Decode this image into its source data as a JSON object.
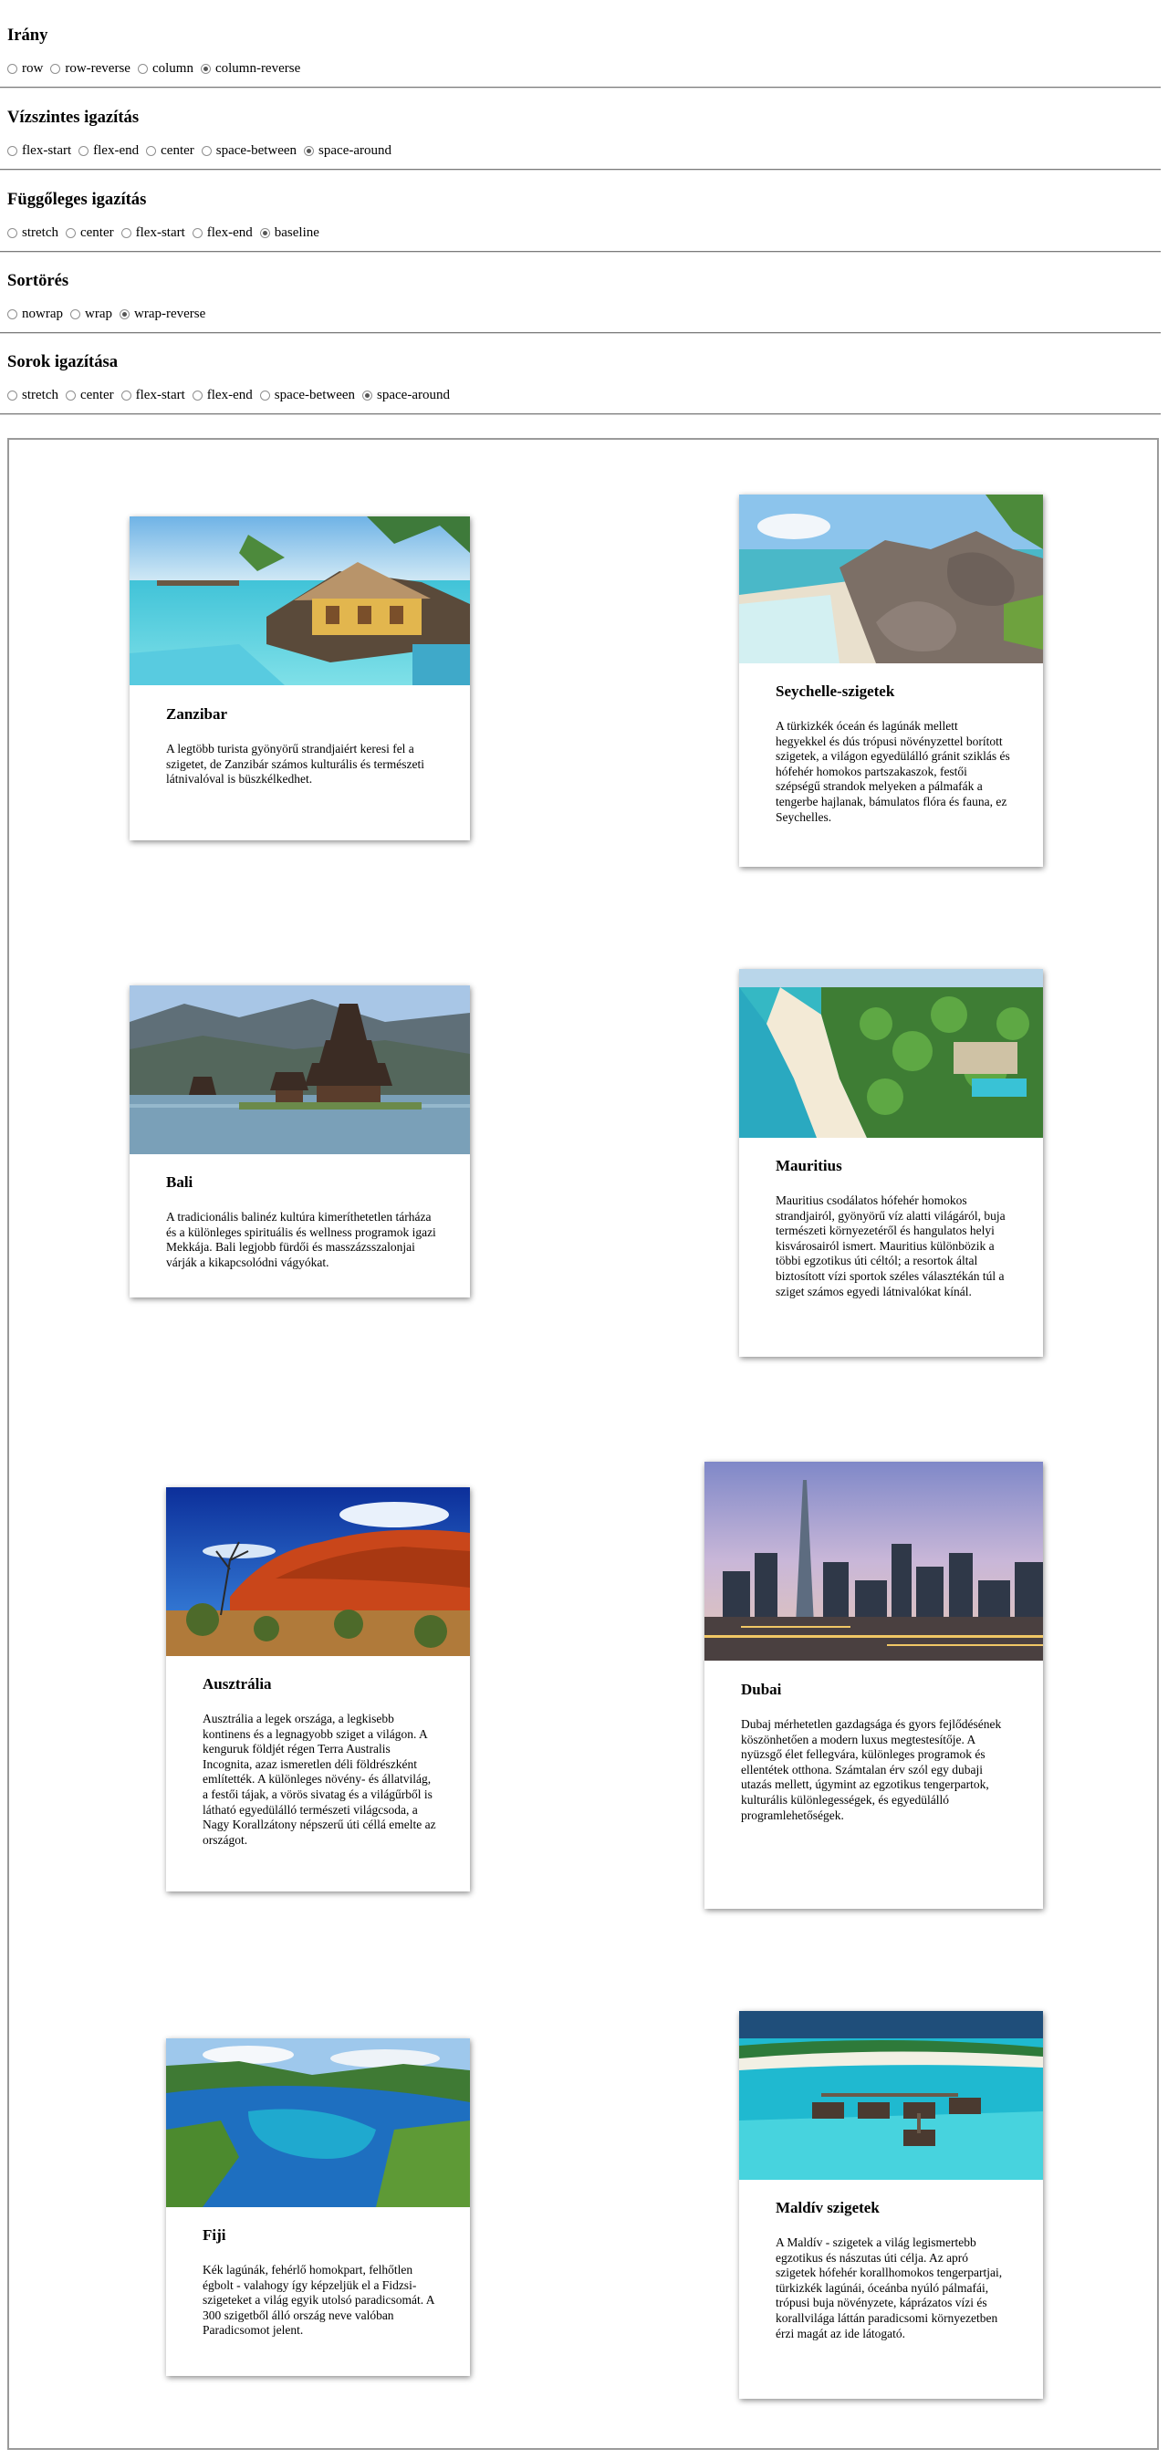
{
  "controls": [
    {
      "title": "Irány",
      "options": [
        "row",
        "row-reverse",
        "column",
        "column-reverse"
      ],
      "selected": 3
    },
    {
      "title": "Vízszintes igazítás",
      "options": [
        "flex-start",
        "flex-end",
        "center",
        "space-between",
        "space-around"
      ],
      "selected": 4
    },
    {
      "title": "Függőleges igazítás",
      "options": [
        "stretch",
        "center",
        "flex-start",
        "flex-end",
        "baseline"
      ],
      "selected": 4
    },
    {
      "title": "Sortörés",
      "options": [
        "nowrap",
        "wrap",
        "wrap-reverse"
      ],
      "selected": 2
    },
    {
      "title": "Sorok igazítása",
      "options": [
        "stretch",
        "center",
        "flex-start",
        "flex-end",
        "space-between",
        "space-around"
      ],
      "selected": 5
    }
  ],
  "cards": [
    {
      "title": "Zanzibar",
      "text": "A legtöbb turista gyönyörű strandjaiért keresi fel a szigetet, de Zanzibár számos kulturális és természeti látnivalóval is büszkélkedhet.",
      "image": "zanzibar-beach-hut"
    },
    {
      "title": "Seychelle-szigetek",
      "text": "A türkizkék óceán és lagúnák mellett hegyekkel és dús trópusi növényzettel borított szigetek, a világon egyedülálló gránit sziklás és hófehér homokos partszakaszok, festői szépségű strandok melyeken a pálmafák a tengerbe hajlanak, bámulatos flóra és fauna, ez Seychelles.",
      "image": "seychelles-granite-rocks"
    },
    {
      "title": "Bali",
      "text": "A tradicionális balinéz kultúra kimeríthetetlen tárháza és a különleges spirituális és wellness programok igazi Mekkája. Bali legjobb fürdői és masszázsszalonjai várják a kikapcsolódni vágyókat.",
      "image": "bali-temple"
    },
    {
      "title": "Mauritius",
      "text": "Mauritius csodálatos hófehér homokos strandjairól, gyönyörű víz alatti világáról, buja természeti környezetéről és hangulatos helyi kisvárosairól ismert. Mauritius különbözik a többi egzotikus úti céltól; a resortok által biztosított vízi sportok széles választékán túl a sziget számos egyedi látnivalókat kínál.",
      "image": "mauritius-beach"
    },
    {
      "title": "Ausztrália",
      "text": "Ausztrália a legek országa, a legkisebb kontinens és a legnagyobb sziget a világon. A kenguruk földjét régen Terra Australis Incognita, azaz ismeretlen déli földrészként említették. A különleges növény- és állatvilág, a festői tájak, a vörös sivatag és a világűrből is látható egyedülálló természeti világcsoda, a Nagy Korallzátony népszerű úti céllá emelte az országot.",
      "image": "australia-uluru"
    },
    {
      "title": "Dubai",
      "text": "Dubaj mérhetetlen gazdagsága és gyors fejlődésének köszönhetően a modern luxus megtestesítője. A nyüzsgő élet fellegvára, különleges programok és ellentétek otthona. Számtalan érv szól egy dubaji utazás mellett, úgymint az egzotikus tengerpartok, kulturális különlegességek, és egyedülálló programlehetőségek.",
      "image": "dubai-skyline"
    },
    {
      "title": "Fiji",
      "text": "Kék lagúnák, fehérlő homokpart, felhőtlen égbolt - valahogy így képzeljük el a Fidzsi-szigeteket a világ egyik utolsó paradicsomát. A 300 szigetből álló ország neve valóban Paradicsomot jelent.",
      "image": "fiji-lagoon"
    },
    {
      "title": "Maldív szigetek",
      "text": "A Maldív - szigetek a világ legismertebb egzotikus és nászutas úti célja. Az apró szigetek hófehér korallhomokos tengerpartjai, türkizkék lagúnái, óceánba nyúló pálmafái, trópusi buja növényzete, káprázatos vízi és korallvilága láttán paradicsomi környezetben érzi magát az ide látogató.",
      "image": "maldives-water-villas"
    }
  ]
}
